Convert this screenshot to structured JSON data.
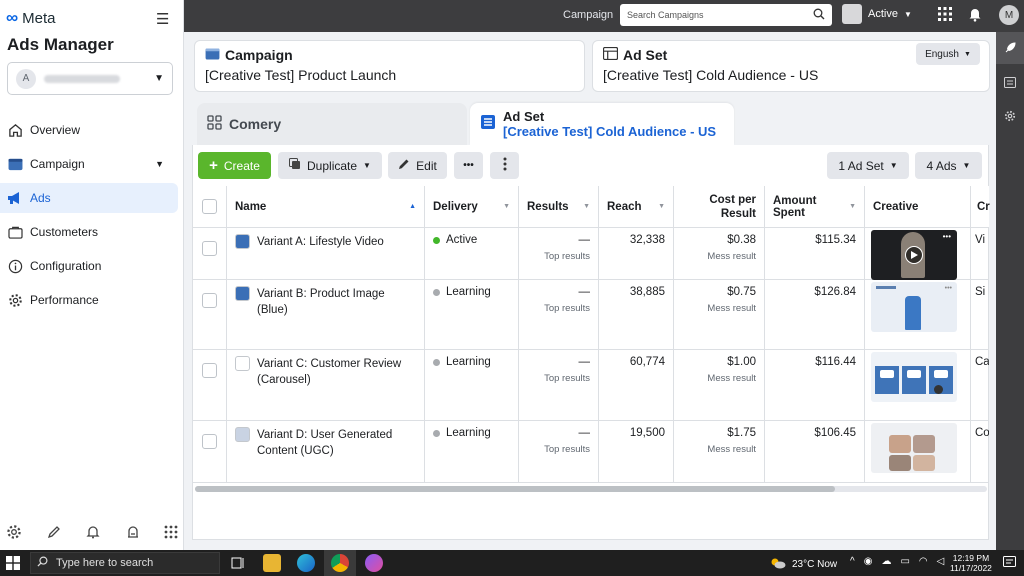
{
  "sidebar": {
    "logo": "Meta",
    "app_title": "Ads Manager",
    "account_initial": "A",
    "items": [
      {
        "label": "Overview"
      },
      {
        "label": "Campaign"
      },
      {
        "label": "Ads"
      },
      {
        "label": "Custometers"
      },
      {
        "label": "Configuration"
      },
      {
        "label": "Performance"
      }
    ]
  },
  "topbar": {
    "campaign_label": "Campaign",
    "search_placeholder": "Search Campaigns",
    "status": "Active",
    "user_initial": "M"
  },
  "breadcrumbs": {
    "campaign_heading": "Campaign",
    "campaign_value": "[Creative Test] Product Launch",
    "adset_heading": "Ad Set",
    "adset_value": "[Creative Test] Cold Audience - US",
    "language": "Engush"
  },
  "tabs": {
    "inactive_label": "Comery",
    "active_heading": "Ad Set",
    "active_value": "[Creative Test] Cold Audience - US"
  },
  "toolbar": {
    "create": "Create",
    "duplicate": "Duplicate",
    "edit": "Edit",
    "more": "•••",
    "adset_filter": "1 Ad Set",
    "ads_filter": "4 Ads"
  },
  "table": {
    "headers": {
      "name": "Name",
      "delivery": "Delivery",
      "results": "Results",
      "reach": "Reach",
      "cost": "Cost per Result",
      "spent": "Amount Spent",
      "creative": "Creative",
      "extra": "Cr"
    },
    "rows": [
      {
        "name": "Variant A: Lifestyle Video",
        "swatch": "#3b6fb6",
        "delivery": "Active",
        "delivery_color": "#42b72a",
        "results": "—",
        "results_sub": "Top results",
        "reach": "32,338",
        "cost": "$0.38",
        "cost_sub": "Mess result",
        "spent": "$115.34",
        "extra": "Vi"
      },
      {
        "name": "Variant B: Product Image (Blue)",
        "swatch": "#3b6fb6",
        "delivery": "Learning",
        "delivery_color": "#a8abaf",
        "results": "—",
        "results_sub": "Top results",
        "reach": "38,885",
        "cost": "$0.75",
        "cost_sub": "Mess result",
        "spent": "$126.84",
        "extra": "Si"
      },
      {
        "name": "Variant C: Customer Review (Carousel)",
        "swatch": "#ffffff",
        "delivery": "Learning",
        "delivery_color": "#a8abaf",
        "results": "—",
        "results_sub": "Top results",
        "reach": "60,774",
        "cost": "$1.00",
        "cost_sub": "Mess result",
        "spent": "$116.44",
        "extra": "Ca"
      },
      {
        "name": "Variant D: User Generated Content (UGC)",
        "swatch": "#c9d3e3",
        "delivery": "Learning",
        "delivery_color": "#a8abaf",
        "results": "—",
        "results_sub": "Top results",
        "reach": "19,500",
        "cost": "$1.75",
        "cost_sub": "Mess result",
        "spent": "$106.45",
        "extra": "Co"
      }
    ]
  },
  "taskbar": {
    "search_placeholder": "Type here to search",
    "weather": "23°C  Now",
    "time": "12:19 PM",
    "date": "11/17/2022"
  }
}
